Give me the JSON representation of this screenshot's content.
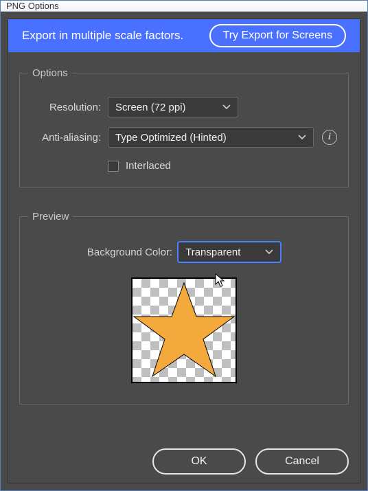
{
  "window": {
    "title": "PNG Options"
  },
  "banner": {
    "text": "Export in multiple scale factors.",
    "try_label": "Try Export for Screens"
  },
  "options": {
    "legend": "Options",
    "resolution_label": "Resolution:",
    "resolution_value": "Screen (72 ppi)",
    "antialias_label": "Anti-aliasing:",
    "antialias_value": "Type Optimized (Hinted)",
    "interlaced_label": "Interlaced",
    "interlaced_checked": false
  },
  "preview": {
    "legend": "Preview",
    "bgcolor_label": "Background Color:",
    "bgcolor_value": "Transparent"
  },
  "footer": {
    "ok": "OK",
    "cancel": "Cancel"
  },
  "icons": {
    "info": "i"
  }
}
